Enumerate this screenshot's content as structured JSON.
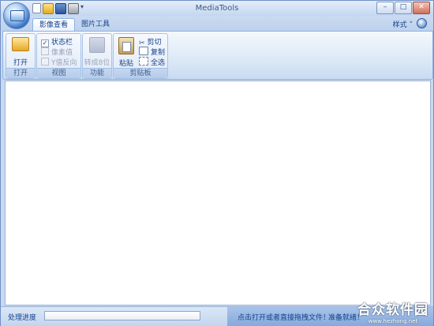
{
  "window": {
    "title": "MediaTools"
  },
  "quick_access": [
    "new-icon",
    "open-icon",
    "save-icon",
    "print-icon"
  ],
  "tabs": [
    {
      "label": "影像查看"
    },
    {
      "label": "图片工具"
    }
  ],
  "style_menu": "样式 ˅",
  "ribbon": {
    "open": {
      "button": "打开",
      "group": "打开"
    },
    "view": {
      "group": "视图",
      "items": [
        {
          "label": "状态栏",
          "checked": true,
          "enabled": true
        },
        {
          "label": "像素值",
          "checked": false,
          "enabled": false
        },
        {
          "label": "Y值反向",
          "checked": false,
          "enabled": false
        }
      ]
    },
    "function": {
      "button": "转成8位",
      "group": "功能"
    },
    "clipboard": {
      "group": "剪贴板",
      "paste": "粘贴",
      "cut": "剪切",
      "copy": "复制",
      "select_all": "全选"
    }
  },
  "status": {
    "progress_label": "处理进度",
    "progress": 0,
    "hint": "点击打开或者直接拖拽文件！",
    "state": "准备就绪！"
  },
  "watermark": {
    "logo": "合众软件园",
    "url": "www.hezhong.net"
  }
}
